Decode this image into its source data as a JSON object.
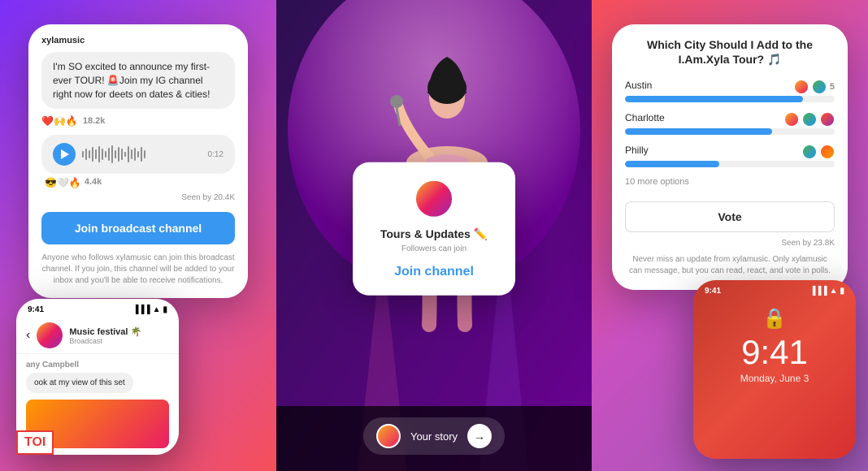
{
  "leftPanel": {
    "username": "xylamusic",
    "messageBubble": "I'm SO excited to announce my first-ever TOUR! 🚨Join my IG channel right now for deets on dates & cities!",
    "messageEmojis": "❤️🙌🔥",
    "messageLikes": "18.2k",
    "audioDuration": "0:12",
    "audioReactions": "😎🤍🔥",
    "audioLikes": "4.4k",
    "seenBy": "Seen by 20.4K",
    "joinButton": "Join broadcast channel",
    "joinDescription": "Anyone who follows xylamusic can join this broadcast channel. If you join, this channel will be added to your inbox and you'll be able to receive notifications."
  },
  "centerPanel": {
    "channelName": "Tours & Updates ✏️",
    "channelMeta": "Followers can join",
    "joinChannelButton": "Join channel",
    "storyLabel": "Your story"
  },
  "rightPanel": {
    "pollTitle": "Which City Should I Add to the I.Am.Xyla Tour? 🎵",
    "options": [
      {
        "city": "Austin",
        "votes": 5,
        "percent": 85
      },
      {
        "city": "Charlotte",
        "percent": 70
      },
      {
        "city": "Philly",
        "percent": 45
      }
    ],
    "moreOptions": "10 more options",
    "voteButton": "Vote",
    "seenBy": "Seen by 23.8K",
    "description": "Never miss an update from xylamusic. Only xylamusic can message, but you can read, react, and vote in polls."
  },
  "bottomLeftPhone": {
    "time": "9:41",
    "chatTitle": "Music festival 🌴",
    "chatSubtitle": "Broadcast",
    "senderName": "any Campbell",
    "message": "ook at my view of this set"
  },
  "bottomRightPhone": {
    "time": "9:41",
    "fullTime": "9:41",
    "date": "Monday, June 3",
    "lockIcon": "🔒"
  }
}
